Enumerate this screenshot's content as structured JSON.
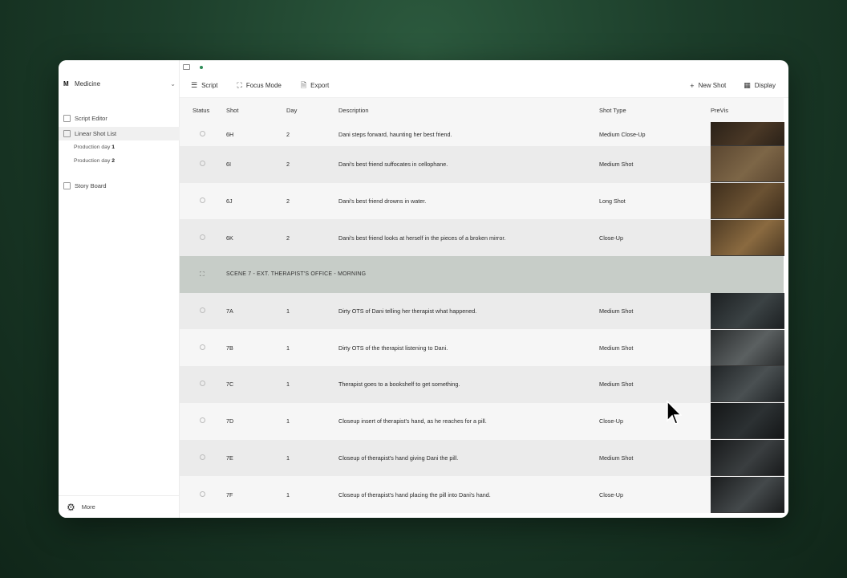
{
  "project": {
    "mark": "M",
    "name": "Medicine"
  },
  "sidebar": {
    "items": [
      {
        "label": "Script Editor",
        "icon": "script-icon"
      },
      {
        "label": "Linear Shot List",
        "icon": "list-icon"
      },
      {
        "label": "Story Board",
        "icon": "storyboard-icon"
      }
    ],
    "sub_items": [
      {
        "prefix": "Production day",
        "num": "1"
      },
      {
        "prefix": "Production day",
        "num": "2"
      }
    ],
    "footer_label": "More"
  },
  "toolbar": {
    "script": "Script",
    "focus_mode": "Focus Mode",
    "export": "Export",
    "new_shot": "New Shot",
    "display": "Display"
  },
  "table": {
    "headers": [
      "Status",
      "Shot",
      "Day",
      "Description",
      "Shot Type",
      "PreVis"
    ],
    "rows": [
      {
        "shot": "6H",
        "day": "2",
        "description": "Dani steps forward, haunting her best friend.",
        "type": "Medium Close-Up",
        "thumb": [
          "#2a2118",
          "#4a3826"
        ]
      },
      {
        "shot": "6I",
        "day": "2",
        "description": "Dani's best friend suffocates in cellophane.",
        "type": "Medium Shot",
        "thumb": [
          "#5a4630",
          "#7d6647"
        ]
      },
      {
        "shot": "6J",
        "day": "2",
        "description": "Dani's best friend drowns in water.",
        "type": "Long Shot",
        "thumb": [
          "#3e2e1c",
          "#6b5233"
        ]
      },
      {
        "shot": "6K",
        "day": "2",
        "description": "Dani's best friend looks at herself in the pieces of a broken mirror.",
        "type": "Close-Up",
        "thumb": [
          "#4e3b24",
          "#8a6a40"
        ]
      },
      {
        "scene": "SCENE 7 - EXT. THERAPIST'S OFFICE - MORNING"
      },
      {
        "shot": "7A",
        "day": "1",
        "description": "Dirty OTS of Dani telling her therapist what happened.",
        "type": "Medium Shot",
        "thumb": [
          "#1c2022",
          "#3b4244"
        ]
      },
      {
        "shot": "7B",
        "day": "1",
        "description": "Dirty OTS of the therapist listening to Dani.",
        "type": "Medium Shot",
        "thumb": [
          "#2a2d2e",
          "#5b6061"
        ]
      },
      {
        "shot": "7C",
        "day": "1",
        "description": "Therapist goes to a bookshelf to get something.",
        "type": "Medium Shot",
        "thumb": [
          "#202426",
          "#4a5052"
        ]
      },
      {
        "shot": "7D",
        "day": "1",
        "description": "Closeup insert of therapist's hand, as he reaches for a pill.",
        "type": "Close-Up",
        "thumb": [
          "#141617",
          "#2c3133"
        ]
      },
      {
        "shot": "7E",
        "day": "1",
        "description": "Closeup of therapist's hand giving Dani the pill.",
        "type": "Medium Shot",
        "thumb": [
          "#181a1b",
          "#3a3e40"
        ]
      },
      {
        "shot": "7F",
        "day": "1",
        "description": "Closeup of therapist's hand placing the pill into Dani's hand.",
        "type": "Close-Up",
        "thumb": [
          "#1a1c1d",
          "#44494b"
        ]
      }
    ]
  }
}
